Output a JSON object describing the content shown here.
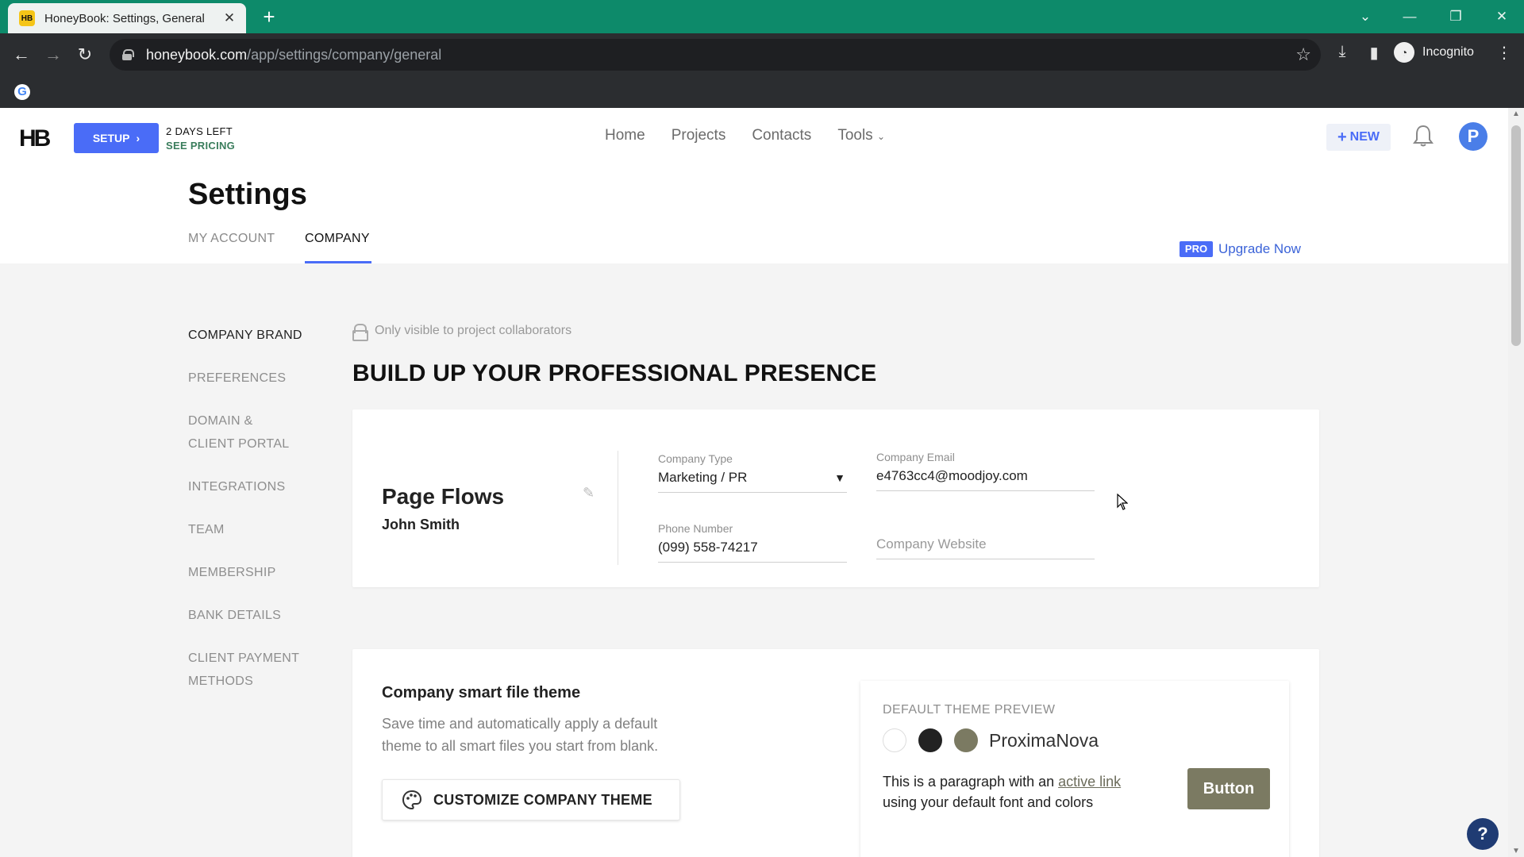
{
  "browser": {
    "tab_title": "HoneyBook: Settings, General",
    "favicon_text": "HB",
    "url_host": "honeybook.com",
    "url_path": "/app/settings/company/general",
    "profile_label": "Incognito"
  },
  "header": {
    "logo": "HB",
    "setup_label": "SETUP",
    "days_left": "2 DAYS LEFT",
    "see_pricing": "SEE PRICING",
    "nav": [
      "Home",
      "Projects",
      "Contacts",
      "Tools"
    ],
    "new_label": "NEW",
    "avatar_initial": "P"
  },
  "settings": {
    "title": "Settings",
    "tabs": [
      "MY ACCOUNT",
      "COMPANY"
    ],
    "active_tab": "COMPANY",
    "pro_badge": "PRO",
    "upgrade_label": "Upgrade Now"
  },
  "sidebar": {
    "items": [
      {
        "label": "COMPANY BRAND",
        "active": true
      },
      {
        "label": "PREFERENCES",
        "active": false
      },
      {
        "label": "DOMAIN &\nCLIENT PORTAL",
        "active": false
      },
      {
        "label": "INTEGRATIONS",
        "active": false
      },
      {
        "label": "TEAM",
        "active": false
      },
      {
        "label": "MEMBERSHIP",
        "active": false
      },
      {
        "label": "BANK DETAILS",
        "active": false
      },
      {
        "label": "CLIENT PAYMENT\nMETHODS",
        "active": false
      }
    ]
  },
  "brand": {
    "visibility_note": "Only visible to project collaborators",
    "section_title": "BUILD UP YOUR PROFESSIONAL PRESENCE",
    "company_name": "Page Flows",
    "owner_name": "John Smith",
    "fields": {
      "company_type": {
        "label": "Company Type",
        "value": "Marketing / PR"
      },
      "company_email": {
        "label": "Company Email",
        "value": "e4763cc4@moodjoy.com"
      },
      "phone_number": {
        "label": "Phone Number",
        "value": "(099) 558-74217"
      },
      "company_website": {
        "placeholder": "Company Website"
      }
    }
  },
  "theme": {
    "title": "Company smart file theme",
    "description": "Save time and automatically apply a default theme to all smart files you start from blank.",
    "customize_label": "CUSTOMIZE COMPANY THEME",
    "preview_label": "DEFAULT THEME PREVIEW",
    "swatches": [
      "#ffffff",
      "#222222",
      "#7b7a62"
    ],
    "font_name": "ProximaNova",
    "paragraph_prefix": "This is a paragraph with an ",
    "link_text": "active link",
    "paragraph_suffix": " using your default font and colors",
    "preview_button": "Button"
  },
  "help_label": "?"
}
